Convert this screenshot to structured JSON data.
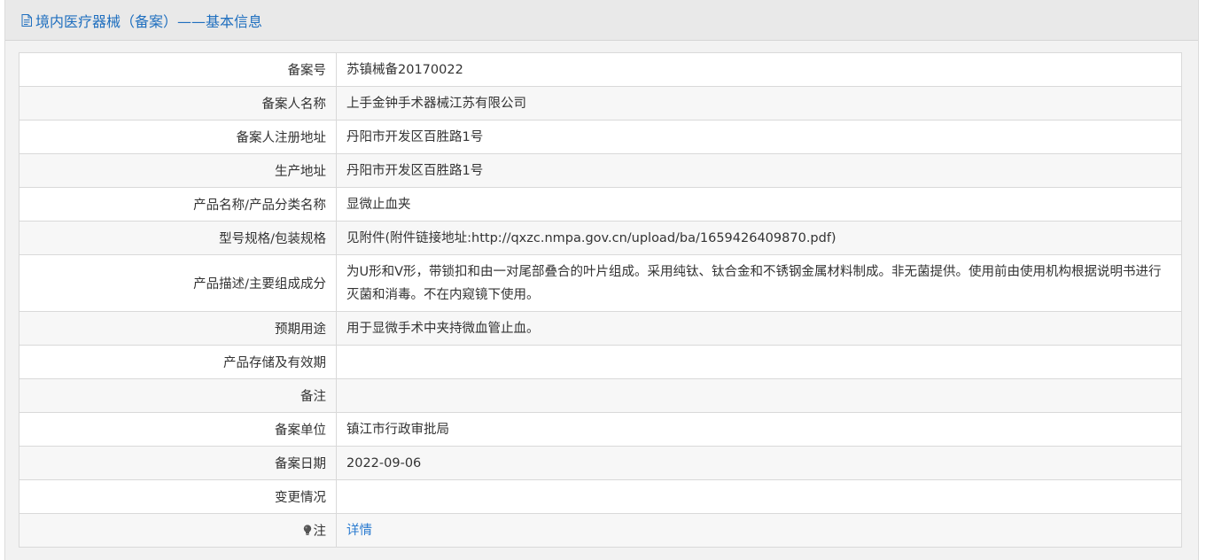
{
  "header": {
    "title": "境内医疗器械（备案）——基本信息",
    "icon": "document-icon",
    "title_color": "#1f6fbf"
  },
  "rows": [
    {
      "label": "备案号",
      "value": "苏镇械备20170022"
    },
    {
      "label": "备案人名称",
      "value": "上手金钟手术器械江苏有限公司"
    },
    {
      "label": "备案人注册地址",
      "value": "丹阳市开发区百胜路1号"
    },
    {
      "label": "生产地址",
      "value": "丹阳市开发区百胜路1号"
    },
    {
      "label": "产品名称/产品分类名称",
      "value": "显微止血夹"
    },
    {
      "label": "型号规格/包装规格",
      "value": "见附件(附件链接地址:http://qxzc.nmpa.gov.cn/upload/ba/1659426409870.pdf)"
    },
    {
      "label": "产品描述/主要组成成分",
      "value": "为U形和V形，带锁扣和由一对尾部叠合的叶片组成。采用纯钛、钛合金和不锈钢金属材料制成。非无菌提供。使用前由使用机构根据说明书进行灭菌和消毒。不在内窥镜下使用。"
    },
    {
      "label": "预期用途",
      "value": "用于显微手术中夹持微血管止血。"
    },
    {
      "label": "产品存储及有效期",
      "value": ""
    },
    {
      "label": "备注",
      "value": ""
    },
    {
      "label": "备案单位",
      "value": "镇江市行政审批局"
    },
    {
      "label": "备案日期",
      "value": "2022-09-06"
    },
    {
      "label": "变更情况",
      "value": ""
    }
  ],
  "note": {
    "label": "注",
    "icon": "lightbulb-icon",
    "link_text": "详情",
    "link_color": "#2a7bd0"
  }
}
